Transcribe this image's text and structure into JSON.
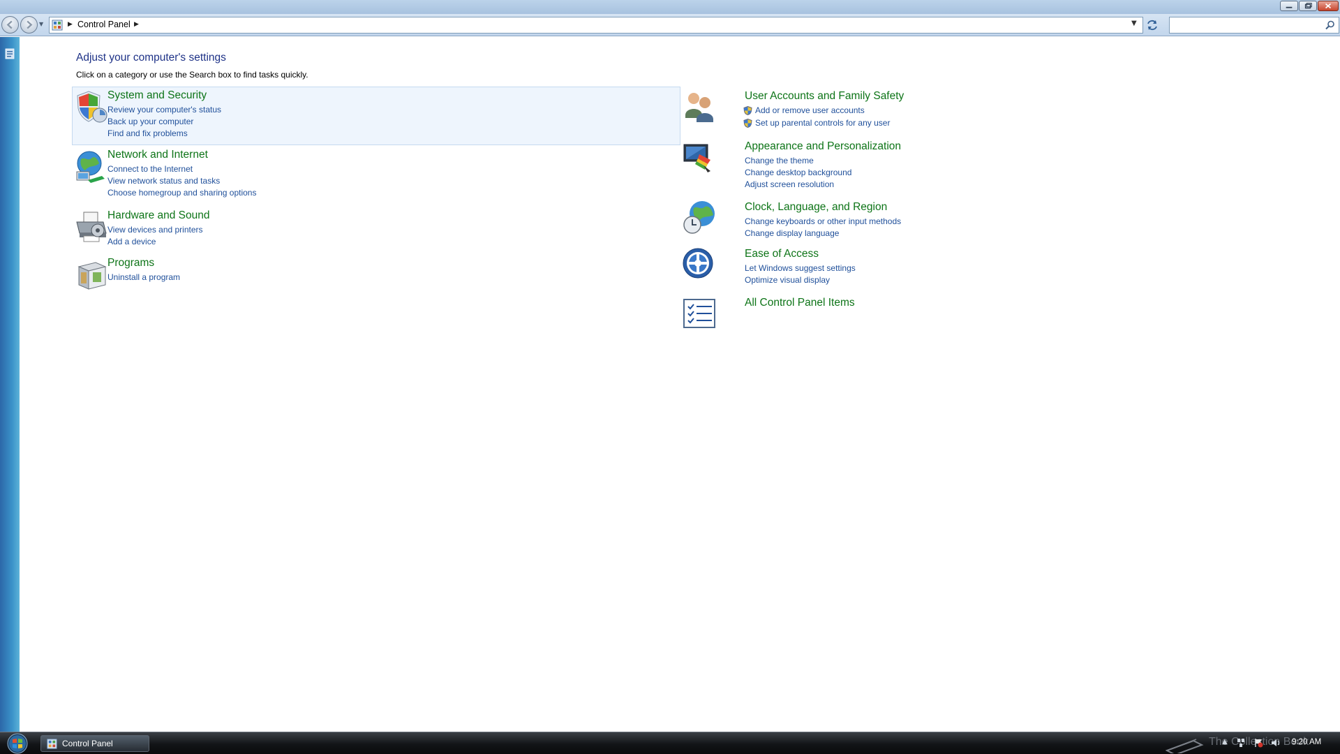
{
  "window": {
    "breadcrumb": [
      "Control Panel"
    ]
  },
  "search": {
    "placeholder": ""
  },
  "main": {
    "title": "Adjust your computer's settings",
    "subtitle": "Click on a category or use the Search box to find tasks quickly."
  },
  "categories": {
    "system_security": {
      "title": "System and Security",
      "icon": "shield-icon",
      "links": [
        "Review your computer's status",
        "Back up your computer",
        "Find and fix problems"
      ]
    },
    "network_internet": {
      "title": "Network and Internet",
      "icon": "network-globe-icon",
      "links": [
        "Connect to the Internet",
        "View network status and tasks",
        "Choose homegroup and sharing options"
      ]
    },
    "hardware_sound": {
      "title": "Hardware and Sound",
      "icon": "printer-icon",
      "links": [
        "View devices and printers",
        "Add a device"
      ]
    },
    "programs": {
      "title": "Programs",
      "icon": "programs-box-icon",
      "links": [
        "Uninstall a program"
      ]
    },
    "user_accounts": {
      "title": "User Accounts and Family Safety",
      "icon": "users-icon",
      "links": [
        "Add or remove user accounts",
        "Set up parental controls for any user"
      ]
    },
    "appearance": {
      "title": "Appearance and Personalization",
      "icon": "monitor-paint-icon",
      "links": [
        "Change the theme",
        "Change desktop background",
        "Adjust screen resolution"
      ]
    },
    "clock_language": {
      "title": "Clock, Language, and Region",
      "icon": "clock-globe-icon",
      "links": [
        "Change keyboards or other input methods",
        "Change display language"
      ]
    },
    "ease_access": {
      "title": "Ease of Access",
      "icon": "ease-of-access-icon",
      "links": [
        "Let Windows suggest settings",
        "Optimize visual display"
      ]
    },
    "all_items": {
      "title": "All Control Panel Items",
      "icon": "checklist-icon",
      "links": []
    }
  },
  "taskbar": {
    "task_label": "Control Panel",
    "watermark": "The Collection Book",
    "clock": "9:20 AM"
  },
  "colors": {
    "category_title": "#0d7417",
    "link": "#1f4f9a",
    "page_title": "#1e3287"
  }
}
